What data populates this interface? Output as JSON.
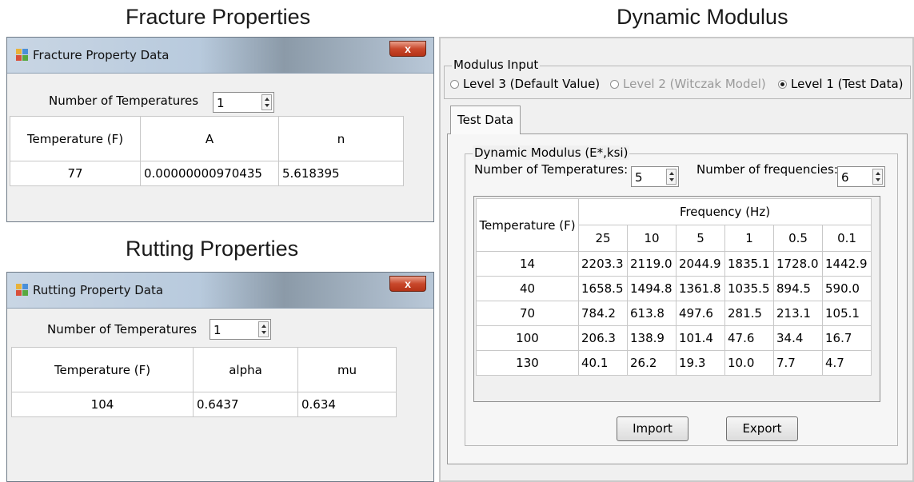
{
  "fracture": {
    "heading": "Fracture Properties",
    "window_title": "Fracture Property Data",
    "close_glyph": "x",
    "num_temps_label": "Number of Temperatures",
    "num_temps_value": "1",
    "columns": [
      "Temperature (F)",
      "A",
      "n"
    ],
    "rows": [
      [
        "77",
        "0.00000000970435",
        "5.618395"
      ]
    ]
  },
  "rutting": {
    "heading": "Rutting Properties",
    "window_title": "Rutting Property Data",
    "close_glyph": "x",
    "num_temps_label": "Number of Temperatures",
    "num_temps_value": "1",
    "columns": [
      "Temperature (F)",
      "alpha",
      "mu"
    ],
    "rows": [
      [
        "104",
        "0.6437",
        "0.634"
      ]
    ]
  },
  "dynamic": {
    "heading": "Dynamic Modulus",
    "modulus_input_legend": "Modulus Input",
    "levels": [
      {
        "label": "Level 3  (Default Value)",
        "selected": false,
        "enabled": true
      },
      {
        "label": "Level 2  (Witczak Model)",
        "selected": false,
        "enabled": false
      },
      {
        "label": "Level 1  (Test Data)",
        "selected": true,
        "enabled": true
      }
    ],
    "tab_label": "Test Data",
    "group_legend": "Dynamic Modulus (E*,ksi)",
    "num_temps_label": "Number of Temperatures:",
    "num_temps_value": "5",
    "num_freq_label": "Number of frequencies:",
    "num_freq_value": "6",
    "temp_header": "Temperature (F)",
    "freq_header": "Frequency (Hz)",
    "frequencies": [
      "25",
      "10",
      "5",
      "1",
      "0.5",
      "0.1"
    ],
    "rows": [
      {
        "temp": "14",
        "values": [
          "2203.3",
          "2119.0",
          "2044.9",
          "1835.1",
          "1728.0",
          "1442.9"
        ]
      },
      {
        "temp": "40",
        "values": [
          "1658.5",
          "1494.8",
          "1361.8",
          "1035.5",
          "894.5",
          "590.0"
        ]
      },
      {
        "temp": "70",
        "values": [
          "784.2",
          "613.8",
          "497.6",
          "281.5",
          "213.1",
          "105.1"
        ]
      },
      {
        "temp": "100",
        "values": [
          "206.3",
          "138.9",
          "101.4",
          "47.6",
          "34.4",
          "16.7"
        ]
      },
      {
        "temp": "130",
        "values": [
          "40.1",
          "26.2",
          "19.3",
          "10.0",
          "7.7",
          "4.7"
        ]
      }
    ],
    "import_label": "Import",
    "export_label": "Export"
  },
  "colors": {
    "close_button": "#c9482b",
    "window_background": "#f0f0f0",
    "grid_line": "#c8c8c8"
  },
  "icons": {
    "app_icon": "app-window-icon",
    "close": "close-icon"
  }
}
